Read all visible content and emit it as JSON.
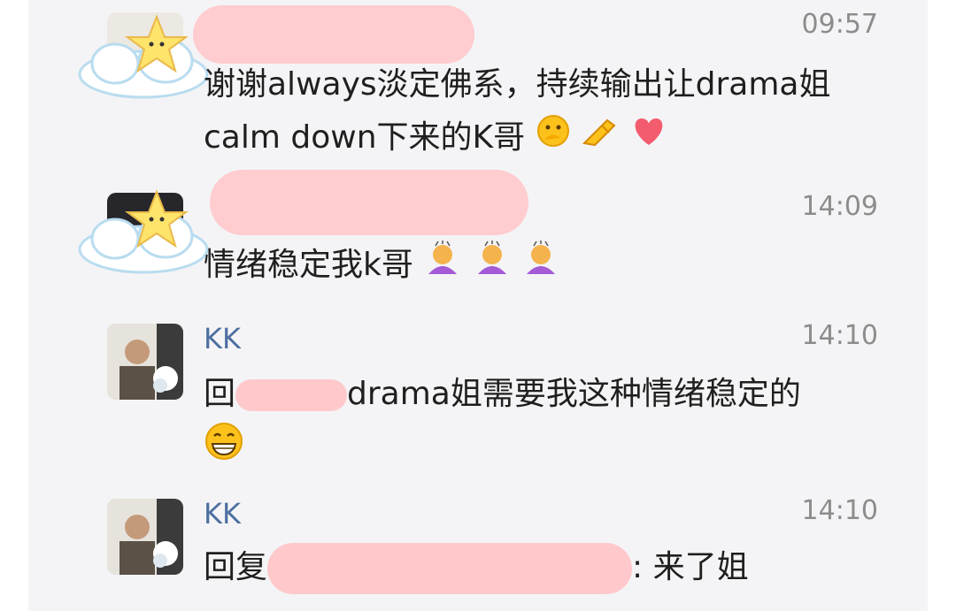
{
  "messages": [
    {
      "time": "09:57",
      "text": "谢谢always淡定佛系，持续输出让drama姐calm down下来的K哥",
      "emojis": [
        "thinking-face",
        "ok-hand",
        "heart"
      ]
    },
    {
      "time": "14:09",
      "text": "情绪稳定我k哥 ",
      "emojis": [
        "bowing-person",
        "bowing-person",
        "bowing-person"
      ]
    },
    {
      "name": "KK",
      "time": "14:10",
      "prefix": "回",
      "text": "drama姐需要我这种情绪稳定的",
      "emojis": [
        "grinning-face"
      ]
    },
    {
      "name": "KK",
      "time": "14:10",
      "prefix": "回复",
      "text": ": 来了姐"
    }
  ],
  "colors": {
    "name": "#4d6fa0",
    "time": "#8c8c8c",
    "redaction": "#ffc9cc",
    "background": "#f4f4f6"
  }
}
